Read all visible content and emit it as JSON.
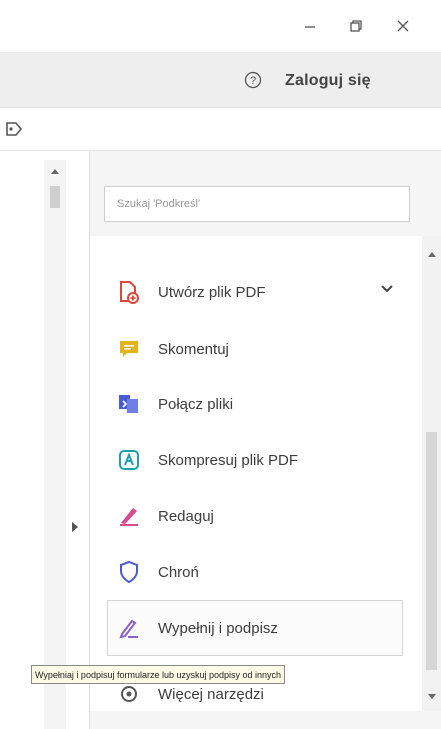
{
  "window": {
    "minimize_icon": "minimize-icon",
    "restore_icon": "restore-icon",
    "close_icon": "close-icon"
  },
  "account": {
    "help_icon": "help-icon",
    "signin_label": "Zaloguj się"
  },
  "search": {
    "placeholder": "Szukaj 'Podkreśl'"
  },
  "tools": [
    {
      "label": "Utwórz plik PDF",
      "icon": "create-pdf-icon",
      "color": "#d9483b",
      "expandable": true
    },
    {
      "label": "Skomentuj",
      "icon": "comment-icon",
      "color": "#e5b31a"
    },
    {
      "label": "Połącz pliki",
      "icon": "combine-files-icon",
      "color": "#4a5bd6"
    },
    {
      "label": "Skompresuj plik PDF",
      "icon": "compress-pdf-icon",
      "color": "#1f9fb2"
    },
    {
      "label": "Redaguj",
      "icon": "redact-icon",
      "color": "#d94b8f"
    },
    {
      "label": "Chroń",
      "icon": "protect-icon",
      "color": "#4a5bd6"
    },
    {
      "label": "Wypełnij i podpisz",
      "icon": "fill-sign-icon",
      "color": "#8b5fc9",
      "selected": true
    },
    {
      "label": "Więcej narzędzi",
      "icon": "more-tools-icon",
      "color": "#555555"
    }
  ],
  "tooltip": {
    "text": "Wypełniaj i podpisuj formularze lub uzyskuj podpisy od innych"
  }
}
